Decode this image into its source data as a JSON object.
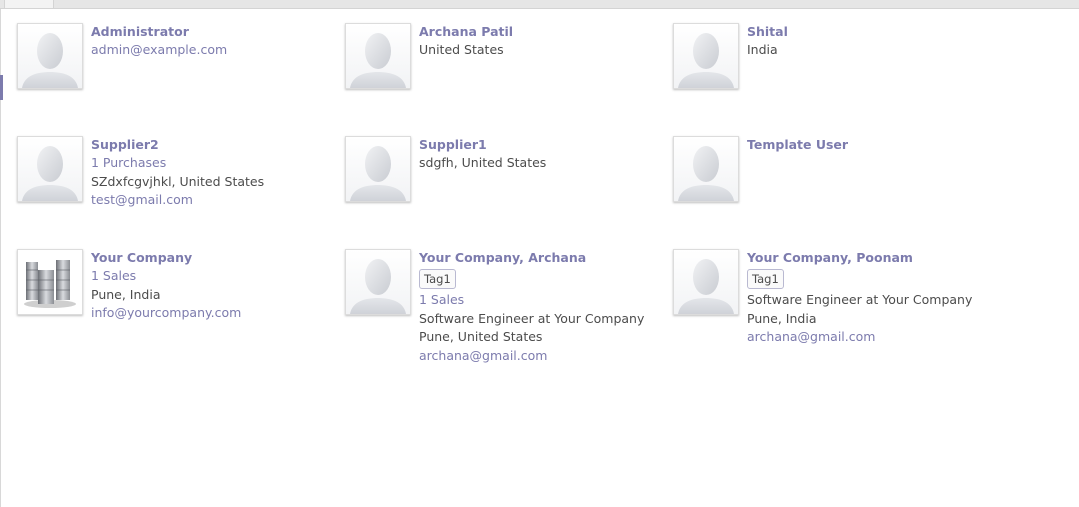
{
  "contacts": [
    {
      "name": "Administrator",
      "lines": [
        {
          "text": "admin@example.com",
          "link": true
        }
      ],
      "avatar": "person-placeholder-icon"
    },
    {
      "name": "Archana Patil",
      "lines": [
        {
          "text": "United States",
          "link": false
        }
      ],
      "avatar": "person-placeholder-icon"
    },
    {
      "name": "Shital",
      "lines": [
        {
          "text": "India",
          "link": false
        }
      ],
      "avatar": "person-placeholder-icon"
    },
    {
      "name": "Supplier2",
      "lines": [
        {
          "text": "1 Purchases",
          "link": true
        },
        {
          "text": "SZdxfcgvjhkl, United States",
          "link": false
        },
        {
          "text": "test@gmail.com",
          "link": true
        }
      ],
      "avatar": "person-placeholder-icon"
    },
    {
      "name": "Supplier1",
      "lines": [
        {
          "text": "sdgfh, United States",
          "link": false
        }
      ],
      "avatar": "person-placeholder-icon"
    },
    {
      "name": "Template User",
      "lines": [],
      "avatar": "person-placeholder-icon"
    },
    {
      "name": "Your Company",
      "lines": [
        {
          "text": "1 Sales",
          "link": true
        },
        {
          "text": "Pune, India",
          "link": false
        },
        {
          "text": "info@yourcompany.com",
          "link": true
        }
      ],
      "avatar": "company-buildings-icon"
    },
    {
      "name": "Your Company, Archana",
      "tag": "Tag1",
      "lines": [
        {
          "text": "1 Sales",
          "link": true
        },
        {
          "text": "Software Engineer at Your Company",
          "link": false
        },
        {
          "text": "Pune, United States",
          "link": false
        },
        {
          "text": "archana@gmail.com",
          "link": true
        }
      ],
      "avatar": "person-placeholder-icon"
    },
    {
      "name": "Your Company, Poonam",
      "tag": "Tag1",
      "lines": [
        {
          "text": "Software Engineer at Your Company",
          "link": false
        },
        {
          "text": "Pune, India",
          "link": false
        },
        {
          "text": "archana@gmail.com",
          "link": true
        }
      ],
      "avatar": "person-placeholder-icon"
    }
  ],
  "colors": {
    "accent": "#7c7bad",
    "text": "#4c4c4c"
  }
}
